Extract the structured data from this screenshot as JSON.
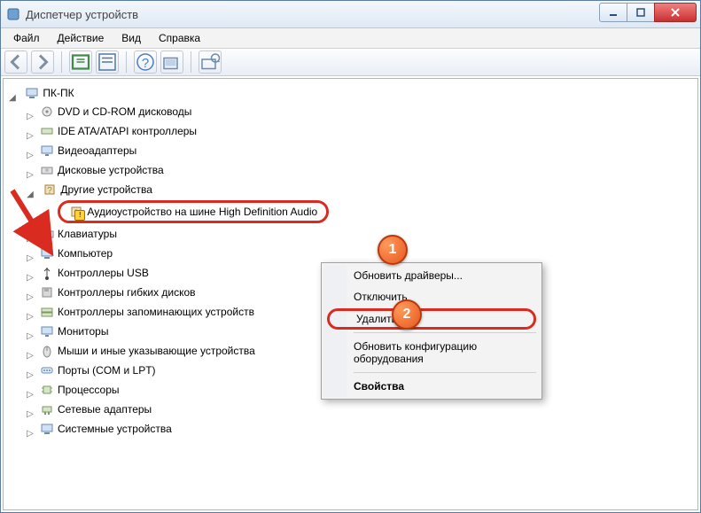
{
  "window": {
    "title": "Диспетчер устройств"
  },
  "menu": {
    "file": "Файл",
    "action": "Действие",
    "view": "Вид",
    "help": "Справка"
  },
  "tree": {
    "root": "ПК-ПК",
    "items": [
      "DVD и CD-ROM дисководы",
      "IDE ATA/ATAPI контроллеры",
      "Видеоадаптеры",
      "Дисковые устройства",
      "Другие устройства",
      "Клавиатуры",
      "Компьютер",
      "Контроллеры USB",
      "Контроллеры гибких дисков",
      "Контроллеры запоминающих устройств",
      "Мониторы",
      "Мыши и иные указывающие устройства",
      "Порты (COM и LPT)",
      "Процессоры",
      "Сетевые адаптеры",
      "Системные устройства"
    ],
    "other_devices_child": "Аудиоустройство на шине High Definition Audio"
  },
  "context_menu": {
    "update_drivers": "Обновить драйверы...",
    "disable": "Отключить",
    "delete": "Удалить",
    "scan_hardware": "Обновить конфигурацию оборудования",
    "properties": "Свойства"
  },
  "annotations": {
    "first": "1",
    "second": "2"
  }
}
